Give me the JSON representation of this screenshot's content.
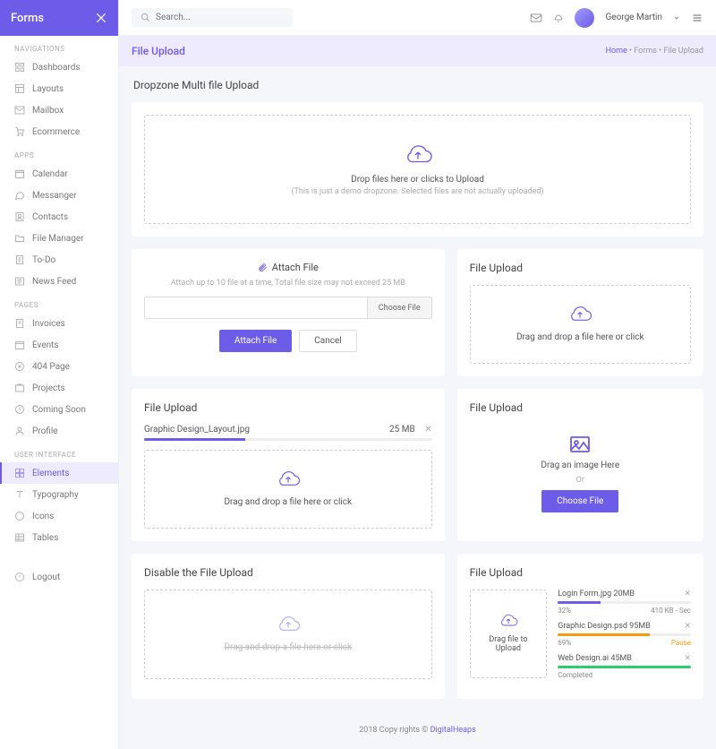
{
  "sidebar": {
    "title": "Forms",
    "sections": [
      {
        "label": "NAVIGATIONS",
        "items": [
          {
            "icon": "dashboard",
            "label": "Dashboards"
          },
          {
            "icon": "layout",
            "label": "Layouts"
          },
          {
            "icon": "mail",
            "label": "Mailbox"
          },
          {
            "icon": "cart",
            "label": "Ecommerce"
          }
        ]
      },
      {
        "label": "APPS",
        "items": [
          {
            "icon": "calendar",
            "label": "Calendar"
          },
          {
            "icon": "message",
            "label": "Messanger"
          },
          {
            "icon": "contacts",
            "label": "Contacts"
          },
          {
            "icon": "folder",
            "label": "File Manager"
          },
          {
            "icon": "todo",
            "label": "To-Do"
          },
          {
            "icon": "news",
            "label": "News Feed"
          }
        ]
      },
      {
        "label": "PAGES",
        "items": [
          {
            "icon": "invoice",
            "label": "Invoices"
          },
          {
            "icon": "event",
            "label": "Events"
          },
          {
            "icon": "404",
            "label": "404 Page"
          },
          {
            "icon": "project",
            "label": "Projects"
          },
          {
            "icon": "soon",
            "label": "Coming Soon"
          },
          {
            "icon": "profile",
            "label": "Profile"
          }
        ]
      },
      {
        "label": "USER INTERFACE",
        "items": [
          {
            "icon": "elements",
            "label": "Elements",
            "active": true
          },
          {
            "icon": "typo",
            "label": "Typography"
          },
          {
            "icon": "icons",
            "label": "Icons"
          },
          {
            "icon": "tables",
            "label": "Tables"
          }
        ]
      }
    ],
    "logout": "Logout"
  },
  "search": {
    "placeholder": "Search..."
  },
  "user": {
    "name": "George Martin"
  },
  "page": {
    "title": "File Upload"
  },
  "breadcrumb": {
    "home": "Home",
    "mid": "Forms",
    "current": "File Upload"
  },
  "dropzone_main": {
    "title": "Dropzone Multi file Upload",
    "text": "Drop files here or clicks to Upload",
    "sub": "(This is just a demo dropzone. Selected files are not actually uploaded)"
  },
  "attach": {
    "title": "Attach File",
    "sub": "Attach up to 10 file at a time, Total file size may not exceed 25 MB",
    "choose": "Choose File",
    "attach_btn": "Attach File",
    "cancel_btn": "Cancel"
  },
  "card_upload": {
    "title": "File Upload",
    "text": "Drag and drop a file here or click"
  },
  "card_progress": {
    "title": "File Upload",
    "file": "Graphic Design_Layout.jpg",
    "size": "25 MB",
    "percent": 35,
    "dz_text": "Drag and drop a file here or click"
  },
  "card_image": {
    "title": "File Upload",
    "text": "Drag an image Here",
    "or": "Or",
    "choose": "Choose File"
  },
  "card_disable": {
    "title": "Disable the File Upload",
    "text": "Drag and drop a file here or click"
  },
  "card_multi": {
    "title": "File Upload",
    "dz_text": "Drag file to Upload",
    "items": [
      {
        "name": "Login Form.jpg 20MB",
        "percent": 32,
        "meta_left": "32%",
        "meta_right": "410 KB - Sec",
        "color": "#6c5ce7"
      },
      {
        "name": "Graphic Design.psd 95MB",
        "percent": 69,
        "meta_left": "69%",
        "meta_right": "Pause",
        "color": "#f39c12",
        "right_color": "#f39c12"
      },
      {
        "name": "Web Design.ai 45MB",
        "percent": 100,
        "meta_left": "Completed",
        "meta_right": "",
        "color": "#2ecc71"
      }
    ]
  },
  "footer": {
    "text": "2018 Copy rights ©",
    "link": "DigitalHeaps"
  }
}
